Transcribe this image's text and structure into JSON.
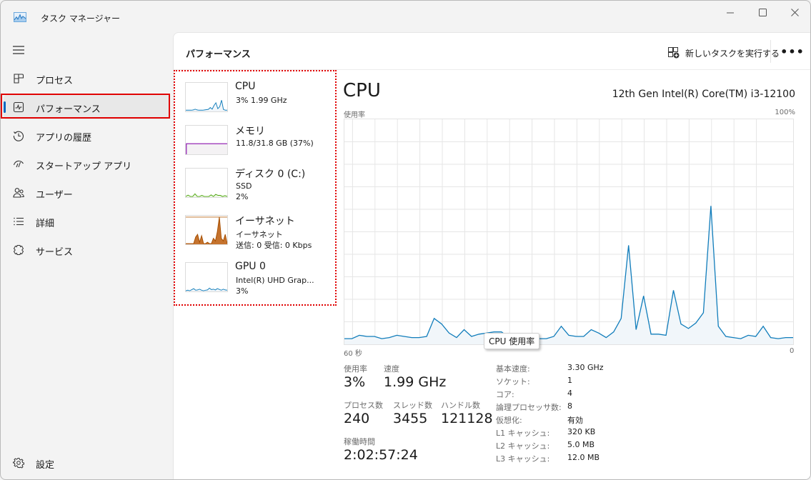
{
  "window": {
    "title": "タスク マネージャー",
    "minimize_label": "—",
    "maximize_label": "☐",
    "close_label": "✕"
  },
  "sidebar": {
    "items": [
      {
        "id": "processes",
        "label": "プロセス",
        "icon": "processes-icon"
      },
      {
        "id": "performance",
        "label": "パフォーマンス",
        "icon": "performance-icon",
        "active": true
      },
      {
        "id": "app-history",
        "label": "アプリの履歴",
        "icon": "history-icon"
      },
      {
        "id": "startup",
        "label": "スタートアップ アプリ",
        "icon": "startup-icon"
      },
      {
        "id": "users",
        "label": "ユーザー",
        "icon": "users-icon"
      },
      {
        "id": "details",
        "label": "詳細",
        "icon": "details-icon"
      },
      {
        "id": "services",
        "label": "サービス",
        "icon": "services-icon"
      }
    ],
    "settings_label": "設定"
  },
  "header": {
    "title": "パフォーマンス",
    "run_task_label": "新しいタスクを実行する",
    "more_label": "•••"
  },
  "devices": [
    {
      "name": "CPU",
      "line1": "3%  1.99 GHz",
      "line2": "",
      "line3": "",
      "color": "#117dbb",
      "fill": "#f1f6fa"
    },
    {
      "name": "メモリ",
      "line1": "11.8/31.8 GB (37%)",
      "line2": "",
      "line3": "",
      "color": "#8b12ae",
      "fill": "#f4f2f4"
    },
    {
      "name": "ディスク 0 (C:)",
      "line1": "SSD",
      "line2": "2%",
      "line3": "",
      "color": "#4da60c",
      "fill": "#eff7e8"
    },
    {
      "name": "イーサネット",
      "line1": "イーサネット",
      "line2": "送信: 0 受信: 0 Kbps",
      "line3": "",
      "color": "#a74f01",
      "fill": "#fcf3eb"
    },
    {
      "name": "GPU 0",
      "line1": "Intel(R) UHD Grap...",
      "line2": "3%",
      "line3": "",
      "color": "#117dbb",
      "fill": "#f1f6fa"
    }
  ],
  "detail": {
    "title": "CPU",
    "model": "12th Gen Intel(R) Core(TM) i3-12100",
    "tooltip": "CPU 使用率",
    "stats": {
      "utilization_label": "使用率",
      "utilization_value": "3%",
      "speed_label": "速度",
      "speed_value": "1.99 GHz",
      "processes_label": "プロセス数",
      "processes_value": "240",
      "threads_label": "スレッド数",
      "threads_value": "3455",
      "handles_label": "ハンドル数",
      "handles_value": "121128",
      "uptime_label": "稼働時間",
      "uptime_value": "2:02:57:24"
    },
    "specs": [
      {
        "key": "基本速度:",
        "value": "3.30 GHz"
      },
      {
        "key": "ソケット:",
        "value": "1"
      },
      {
        "key": "コア:",
        "value": "4"
      },
      {
        "key": "論理プロセッサ数:",
        "value": "8"
      },
      {
        "key": "仮想化:",
        "value": "有効"
      },
      {
        "key": "L1 キャッシュ:",
        "value": "320 KB"
      },
      {
        "key": "L2 キャッシュ:",
        "value": "5.0 MB"
      },
      {
        "key": "L3 キャッシュ:",
        "value": "12.0 MB"
      }
    ]
  },
  "chart_data": {
    "type": "area",
    "title": "CPU",
    "ylabel": "使用率",
    "ymax_label": "100%",
    "xlabel_left": "60 秒",
    "xlabel_right": "0",
    "ylim": [
      0,
      100
    ],
    "xlim": [
      60,
      0
    ],
    "grid": true,
    "line_color": "#117dbb",
    "fill_color": "#f1f6fa",
    "series": [
      {
        "name": "CPU 使用率",
        "values": [
          2.5,
          2.5,
          4,
          3.5,
          3.5,
          2.5,
          3,
          4,
          3.5,
          3,
          3,
          3.5,
          11.5,
          9,
          5,
          3,
          6.5,
          3.5,
          4.5,
          5,
          5.5,
          5.5,
          3,
          3,
          3,
          3,
          2.5,
          2.5,
          3.5,
          8,
          4,
          3.5,
          3.5,
          6.5,
          5,
          3,
          5.5,
          11.5,
          44,
          6.5,
          21.5,
          4.5,
          4.5,
          4,
          24,
          9,
          7,
          9.5,
          14,
          61.5,
          8,
          3.5,
          3,
          2.5,
          4,
          3.5,
          8,
          3,
          2.5,
          3,
          3
        ]
      }
    ]
  },
  "thumbnails": {
    "cpu": [
      2,
      2,
      2,
      2,
      3,
      6,
      3,
      2,
      2,
      2,
      3,
      4,
      5,
      12,
      6,
      20,
      30,
      8,
      15,
      40,
      5,
      2,
      2
    ],
    "memory": [
      37
    ],
    "disk": [
      0,
      5,
      0,
      0,
      10,
      0,
      0,
      4,
      0,
      0,
      0,
      6,
      0,
      8,
      4,
      4,
      0,
      3,
      0
    ],
    "ethernet": [
      0,
      0,
      0,
      0,
      0,
      25,
      35,
      5,
      30,
      0,
      0,
      5,
      0,
      0,
      20,
      10,
      45,
      100,
      20,
      10,
      35,
      0
    ],
    "gpu": [
      0,
      2,
      0,
      4,
      8,
      2,
      3,
      6,
      2,
      0,
      2,
      3,
      10,
      4,
      6,
      3,
      8,
      5,
      2,
      6,
      3,
      2
    ]
  }
}
